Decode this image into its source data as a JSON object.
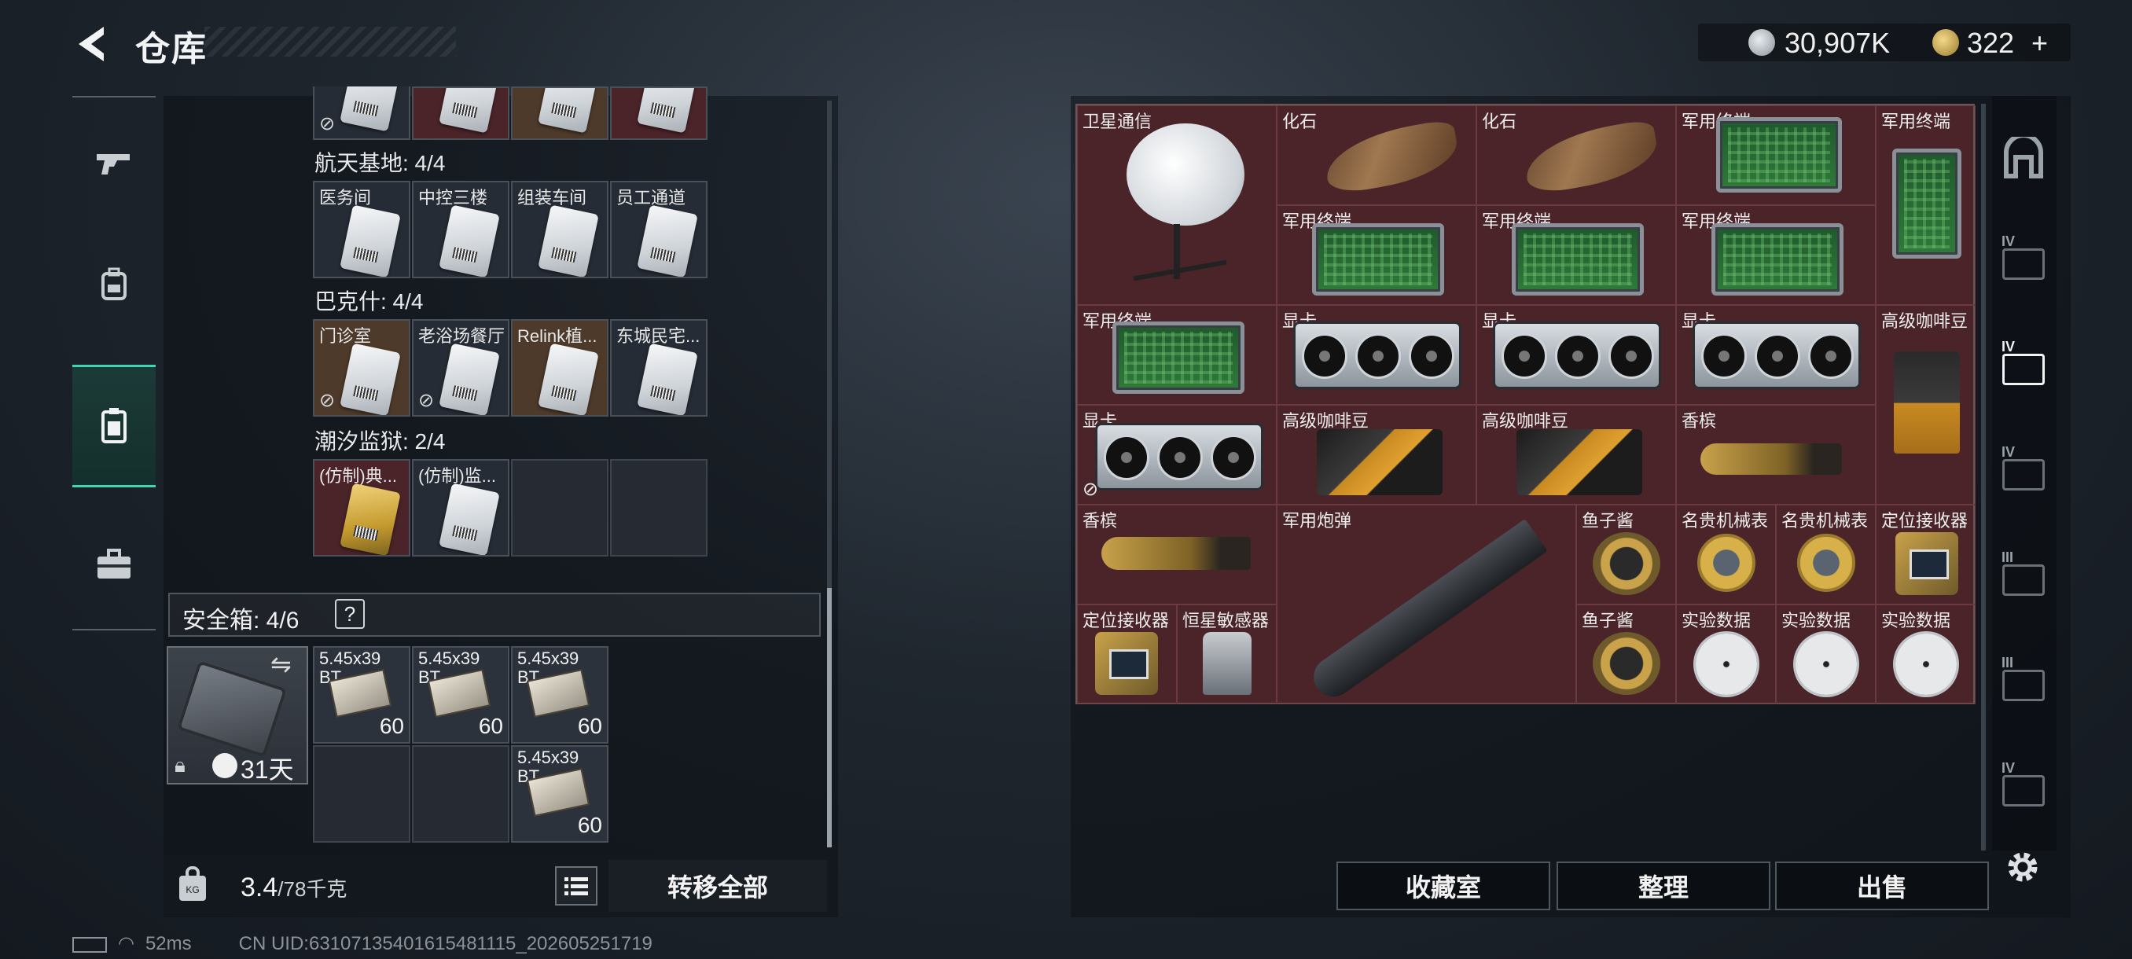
{
  "header": {
    "title": "仓库",
    "currency_1": "30,907K",
    "currency_2": "322",
    "currency_add": "+"
  },
  "left_tabs": [
    {
      "name": "weapons",
      "icon": "gun-icon"
    },
    {
      "name": "gear",
      "icon": "backpack-icon"
    },
    {
      "name": "keys",
      "icon": "keycard-icon",
      "active": true
    },
    {
      "name": "toolbox",
      "icon": "toolbox-icon"
    }
  ],
  "key_groups": [
    {
      "title": "航天基地: 4/4",
      "cards": [
        "医务间",
        "中控三楼",
        "组装车间",
        "员工通道"
      ]
    },
    {
      "title": "巴克什: 4/4",
      "cards": [
        "门诊室",
        "老浴场餐厅",
        "Relink植...",
        "东城民宅..."
      ]
    },
    {
      "title": "潮汐监狱: 2/4",
      "cards": [
        "(仿制)典...",
        "(仿制)监..."
      ]
    }
  ],
  "secure_box": {
    "title": "安全箱: 4/6",
    "help": "?",
    "days": "31天",
    "ammo": [
      {
        "label": "5.45x39 BT",
        "count": "60"
      },
      {
        "label": "5.45x39 BT",
        "count": "60"
      },
      {
        "label": "5.45x39 BT",
        "count": "60"
      },
      {
        "label": "5.45x39 BT",
        "count": "60"
      }
    ]
  },
  "weight": {
    "value": "3.4",
    "max": "/78千克"
  },
  "transfer_all": "转移全部",
  "status": {
    "ping": "52ms",
    "uid": "CN UID:63107135401615481115_202605251719"
  },
  "items": [
    {
      "label": "卫星通信"
    },
    {
      "label": "化石"
    },
    {
      "label": "化石"
    },
    {
      "label": "军用终端"
    },
    {
      "label": "军用终端"
    },
    {
      "label": "军用终端"
    },
    {
      "label": "军用终端"
    },
    {
      "label": "军用终端"
    },
    {
      "label": "军用终端"
    },
    {
      "label": "显卡"
    },
    {
      "label": "显卡"
    },
    {
      "label": "显卡"
    },
    {
      "label": "高级咖啡豆"
    },
    {
      "label": "显卡"
    },
    {
      "label": "高级咖啡豆"
    },
    {
      "label": "高级咖啡豆"
    },
    {
      "label": "香槟"
    },
    {
      "label": "香槟"
    },
    {
      "label": "军用炮弹"
    },
    {
      "label": "鱼子酱"
    },
    {
      "label": "名贵机械表"
    },
    {
      "label": "名贵机械表"
    },
    {
      "label": "定位接收器"
    },
    {
      "label": "定位接收器"
    },
    {
      "label": "恒星敏感器"
    },
    {
      "label": "鱼子酱"
    },
    {
      "label": "实验数据"
    },
    {
      "label": "实验数据"
    },
    {
      "label": "实验数据"
    }
  ],
  "right_tabs": [
    {
      "icon": "base-icon"
    },
    {
      "icon": "tier-iv-slot-icon",
      "tier": "IV"
    },
    {
      "icon": "tier-iv-slot-icon",
      "tier": "IV",
      "active": true
    },
    {
      "icon": "tier-iv-slot-icon",
      "tier": "IV"
    },
    {
      "icon": "tier-iii-slot-icon",
      "tier": "III"
    },
    {
      "icon": "tier-iii-slot-icon",
      "tier": "III"
    },
    {
      "icon": "tier-iv-slot-icon",
      "tier": "IV"
    }
  ],
  "buttons": {
    "collection": "收藏室",
    "sort": "整理",
    "sell": "出售"
  },
  "colors": {
    "accent": "#3fd6b4",
    "item_bg": "#4a2428"
  }
}
